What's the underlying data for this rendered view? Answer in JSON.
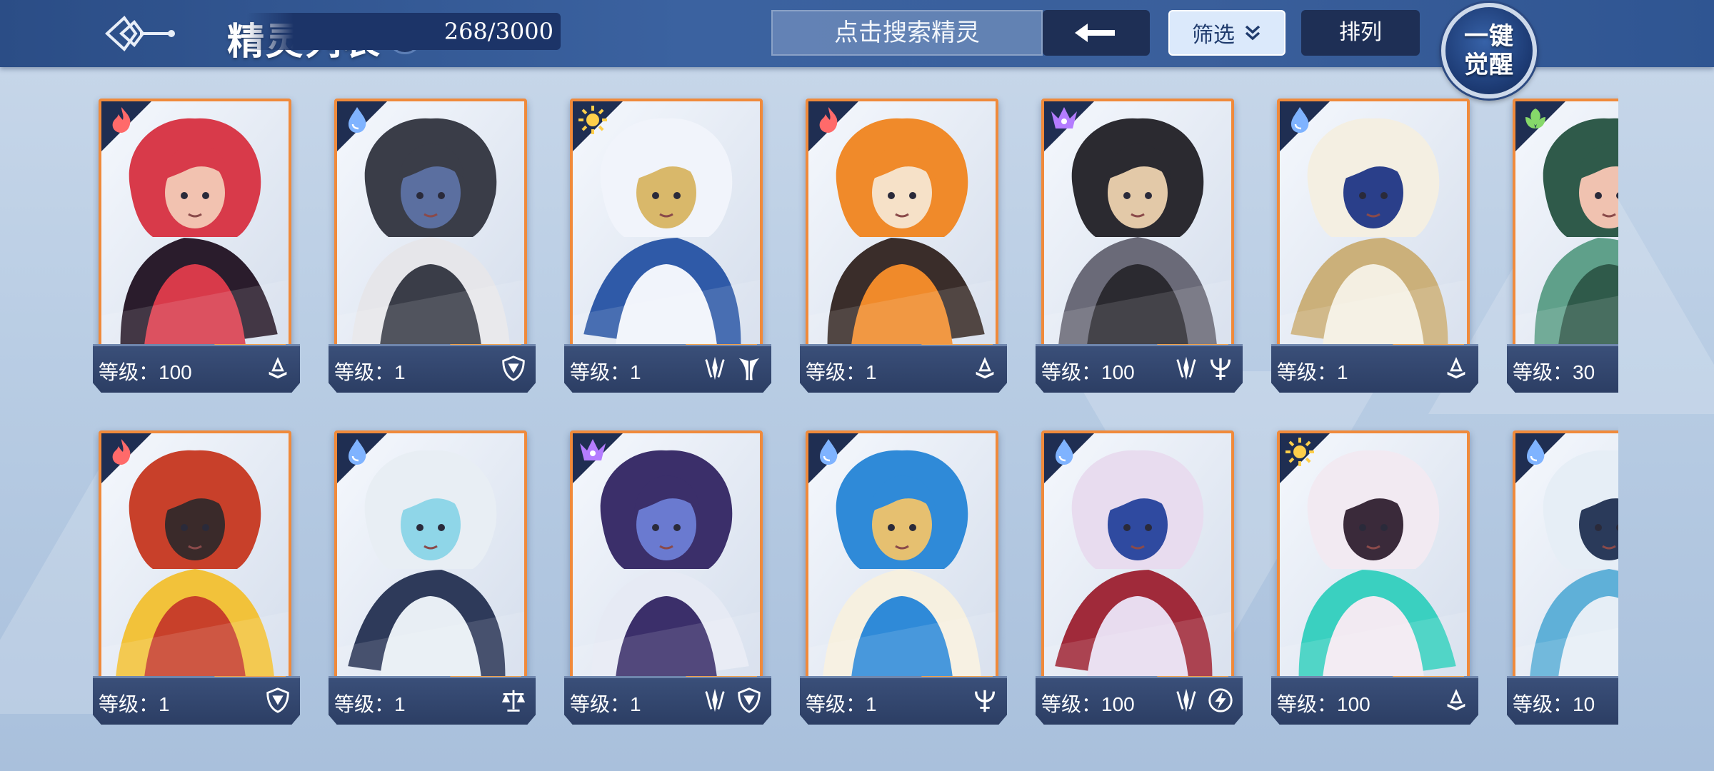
{
  "header": {
    "title": "精灵列表",
    "help_label": "?",
    "count": "268/3000",
    "search_placeholder": "点击搜索精灵",
    "filter_label": "筛选",
    "sort_label": "排列",
    "awaken_line1": "一键",
    "awaken_line2": "觉醒"
  },
  "colors": {
    "fire": "#ff6a6a",
    "water": "#7fb3ff",
    "light": "#ffcf4a",
    "dark": "#b47cff",
    "grass": "#86d86a",
    "frame_orange": "#f08a3b"
  },
  "rows": [
    [
      {
        "element": "fire",
        "level": "等级：100",
        "badges": [
          "book-icon"
        ],
        "palette": [
          "#d83a4a",
          "#2a1c2c",
          "#f2c2b0"
        ]
      },
      {
        "element": "water",
        "level": "等级：1",
        "badges": [
          "shield-icon"
        ],
        "palette": [
          "#3a3d48",
          "#e6e6ea",
          "#5b6fa0"
        ]
      },
      {
        "element": "light",
        "level": "等级：1",
        "badges": [
          "claw-icon",
          "wing-icon"
        ],
        "palette": [
          "#f1f4fb",
          "#2f5aa8",
          "#d9b86a"
        ]
      },
      {
        "element": "fire",
        "level": "等级：1",
        "badges": [
          "book-icon"
        ],
        "palette": [
          "#f08a2a",
          "#3a2d2a",
          "#f6e1c8"
        ]
      },
      {
        "element": "dark",
        "level": "等级：100",
        "badges": [
          "claw-icon",
          "trident-icon"
        ],
        "palette": [
          "#2b2a30",
          "#6a6a78",
          "#e3c9a8"
        ]
      },
      {
        "element": "water",
        "level": "等级：1",
        "badges": [
          "book-icon"
        ],
        "palette": [
          "#f4efe2",
          "#cbb07a",
          "#2a3f8a"
        ]
      },
      {
        "element": "grass",
        "level": "等级：30",
        "badges": [],
        "palette": [
          "#2f5a4a",
          "#5fa08a",
          "#f0c2b0"
        ]
      }
    ],
    [
      {
        "element": "fire",
        "level": "等级：1",
        "badges": [
          "shield-icon"
        ],
        "palette": [
          "#c8402a",
          "#f2c23a",
          "#3a2a2a"
        ]
      },
      {
        "element": "water",
        "level": "等级：1",
        "badges": [
          "scale-icon"
        ],
        "palette": [
          "#e8eef4",
          "#2e3a5a",
          "#8fd6e8"
        ]
      },
      {
        "element": "dark",
        "level": "等级：1",
        "badges": [
          "claw-icon",
          "shield-icon"
        ],
        "palette": [
          "#3b2f6a",
          "#e6eaf4",
          "#6a7ad0"
        ]
      },
      {
        "element": "water",
        "level": "等级：1",
        "badges": [
          "trident-icon"
        ],
        "palette": [
          "#2f8ad8",
          "#f6f0e0",
          "#e6c070"
        ]
      },
      {
        "element": "water",
        "level": "等级：100",
        "badges": [
          "claw-icon",
          "bolt-icon"
        ],
        "palette": [
          "#e8dcef",
          "#a02a3a",
          "#2f4aa0"
        ]
      },
      {
        "element": "light",
        "level": "等级：100",
        "badges": [
          "book-icon"
        ],
        "palette": [
          "#f2eaf2",
          "#3ad0c0",
          "#3a2a3a"
        ]
      },
      {
        "element": "water",
        "level": "等级：10",
        "badges": [],
        "palette": [
          "#e6eef6",
          "#5fb0d8",
          "#2a3a5a"
        ]
      }
    ]
  ]
}
